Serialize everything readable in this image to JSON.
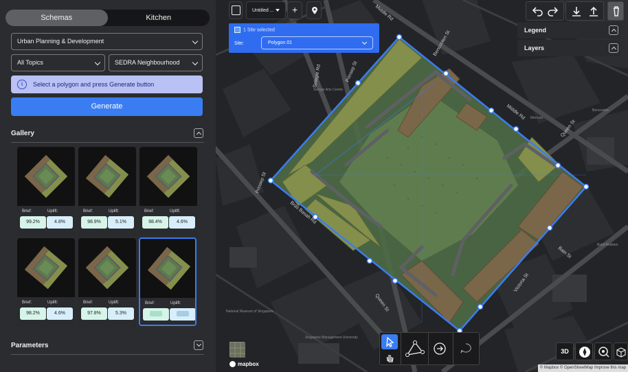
{
  "sidebar": {
    "tabs": [
      {
        "label": "Schemas",
        "active": true
      },
      {
        "label": "Kitchen",
        "active": false
      }
    ],
    "category_select": "Urban Planning & Development",
    "topic_select": "All Topics",
    "neighbourhood_select": "SEDRA Neighbourhood",
    "info_text": "Select a polygon and press Generate button",
    "info_icon": "i",
    "generate_label": "Generate",
    "gallery_title": "Gallery",
    "parameters_title": "Parameters",
    "gallery": [
      {
        "brief_label": "Brief:",
        "uplift_label": "Uplift:",
        "brief": "99.2%",
        "uplift": "4.8%"
      },
      {
        "brief_label": "Brief:",
        "uplift_label": "Uplift:",
        "brief": "98.9%",
        "uplift": "5.1%"
      },
      {
        "brief_label": "Brief:",
        "uplift_label": "Uplift:",
        "brief": "98.4%",
        "uplift": "4.6%"
      },
      {
        "brief_label": "Brief:",
        "uplift_label": "Uplift:",
        "brief": "98.2%",
        "uplift": "4.6%"
      },
      {
        "brief_label": "Brief:",
        "uplift_label": "Uplift:",
        "brief": "97.8%",
        "uplift": "5.3%"
      },
      {
        "brief_label": "Brief:",
        "uplift_label": "Uplift:",
        "brief": "",
        "uplift": "",
        "selected": true
      }
    ]
  },
  "map": {
    "toolbar": {
      "doc_title": "Untitled ...",
      "add": "+"
    },
    "site_panel": {
      "header": "1 Site selected",
      "site_label": "Site:",
      "site_value": "Polygon 01"
    },
    "panels": [
      {
        "label": "Legend"
      },
      {
        "label": "Layers"
      }
    ],
    "bottom_tools": {
      "view_3d": "3D"
    },
    "attribution": "© Mapbox © OpenStreetMap  Improve this map",
    "logo_text": "mapbox",
    "streets": [
      "Middle Rd",
      "Bencoolen St",
      "Prinsep St",
      "Selegie Rd",
      "Middle Rd",
      "Queen St",
      "Prinsep St",
      "Bras Basah Rd",
      "Bain St",
      "Victoria St",
      "Queen St",
      "National Museum of Singapore",
      "Singapore Management University",
      "Selegie Arts Centre",
      "Mercure",
      "Bencoolen",
      "Bukit Hokkien"
    ],
    "colors": {
      "accent": "#3a7df2",
      "plot_green": "#889450",
      "plot_brown": "#7a6648",
      "park": "#5c7a4c"
    }
  }
}
